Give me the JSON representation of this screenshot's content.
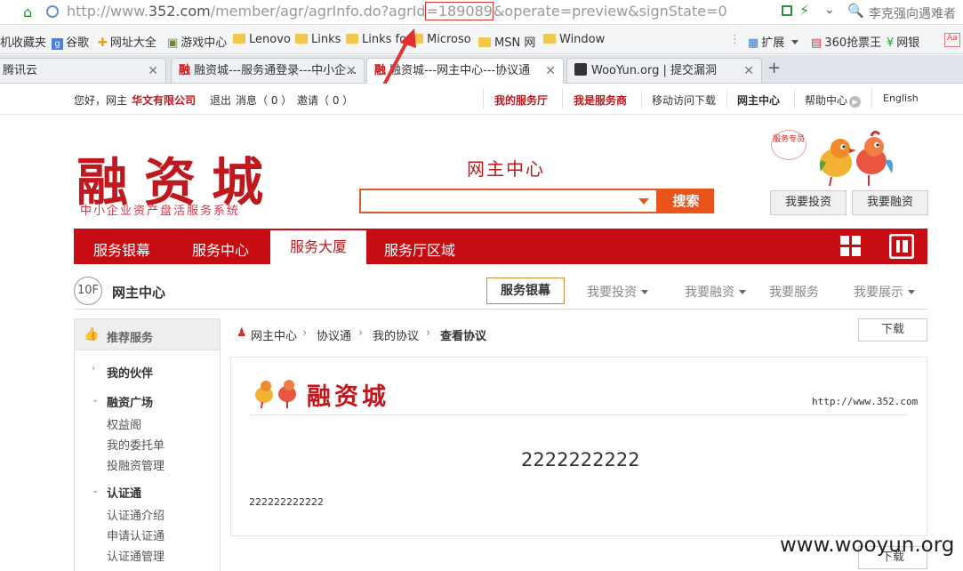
{
  "browser": {
    "url_prefix": "http://www.",
    "url_host": "352.com",
    "url_path": "/member/agr/agrInfo.do?agrId",
    "url_id": "=189089",
    "url_suffix": "&operate=preview&signState=0",
    "search_box": "李克强向遇难者",
    "bookmarks": [
      "机收藏夹",
      "谷歌",
      "网址大全",
      "游戏中心",
      "Lenovo",
      "Links",
      "Links for",
      "Microso",
      "MSN 网",
      "Window",
      "扩展",
      "360抢票王",
      "网银"
    ],
    "tabs": [
      {
        "label": "腾讯云"
      },
      {
        "label": "融资城---服务通登录---中小企..."
      },
      {
        "label": "融资城---网主中心---协议通"
      },
      {
        "label": "WooYun.org | 提交漏洞"
      }
    ]
  },
  "userbar": {
    "greeting": "您好，网主",
    "company": "华文有限公司",
    "logout": "退出",
    "messages": "消息（ 0 ）",
    "invite": "邀请（ 0 ）",
    "links": [
      "我的服务厅",
      "我是服务商",
      "移动访问下载",
      "网主中心",
      "帮助中心",
      "English"
    ]
  },
  "header": {
    "logo": "融资城",
    "slogan": "中小企业资产盘活服务系统",
    "center_title": "网主中心",
    "search_button": "搜索",
    "mascot_badge": "服务专员",
    "invest_button": "我要投资",
    "finance_button": "我要融资"
  },
  "nav": {
    "items": [
      "服务银幕",
      "服务中心",
      "服务大厦",
      "服务厅区域"
    ],
    "active_index": 2
  },
  "floorbar": {
    "floor": "10F",
    "title": "网主中心",
    "items": [
      "服务银幕",
      "我要投资",
      "我要融资",
      "我要服务",
      "我要展示"
    ]
  },
  "sidebar": {
    "header": "推荐服务",
    "groups": [
      {
        "title": "我的伙伴",
        "items": []
      },
      {
        "title": "融资广场",
        "items": [
          "权益阁",
          "我的委托单",
          "投融资管理"
        ]
      },
      {
        "title": "认证通",
        "items": [
          "认证通介绍",
          "申请认证通",
          "认证通管理"
        ]
      }
    ]
  },
  "breadcrumb": [
    "网主中心",
    "协议通",
    "我的协议",
    "查看协议"
  ],
  "download_label": "下载",
  "agreement": {
    "logo": "融资城",
    "url": "http://www.352.com",
    "title": "2222222222",
    "body": "222222222222"
  },
  "watermark": "www.wooyun.org",
  "colors": {
    "brand_red": "#c60b12",
    "search_orange": "#e9541a"
  }
}
